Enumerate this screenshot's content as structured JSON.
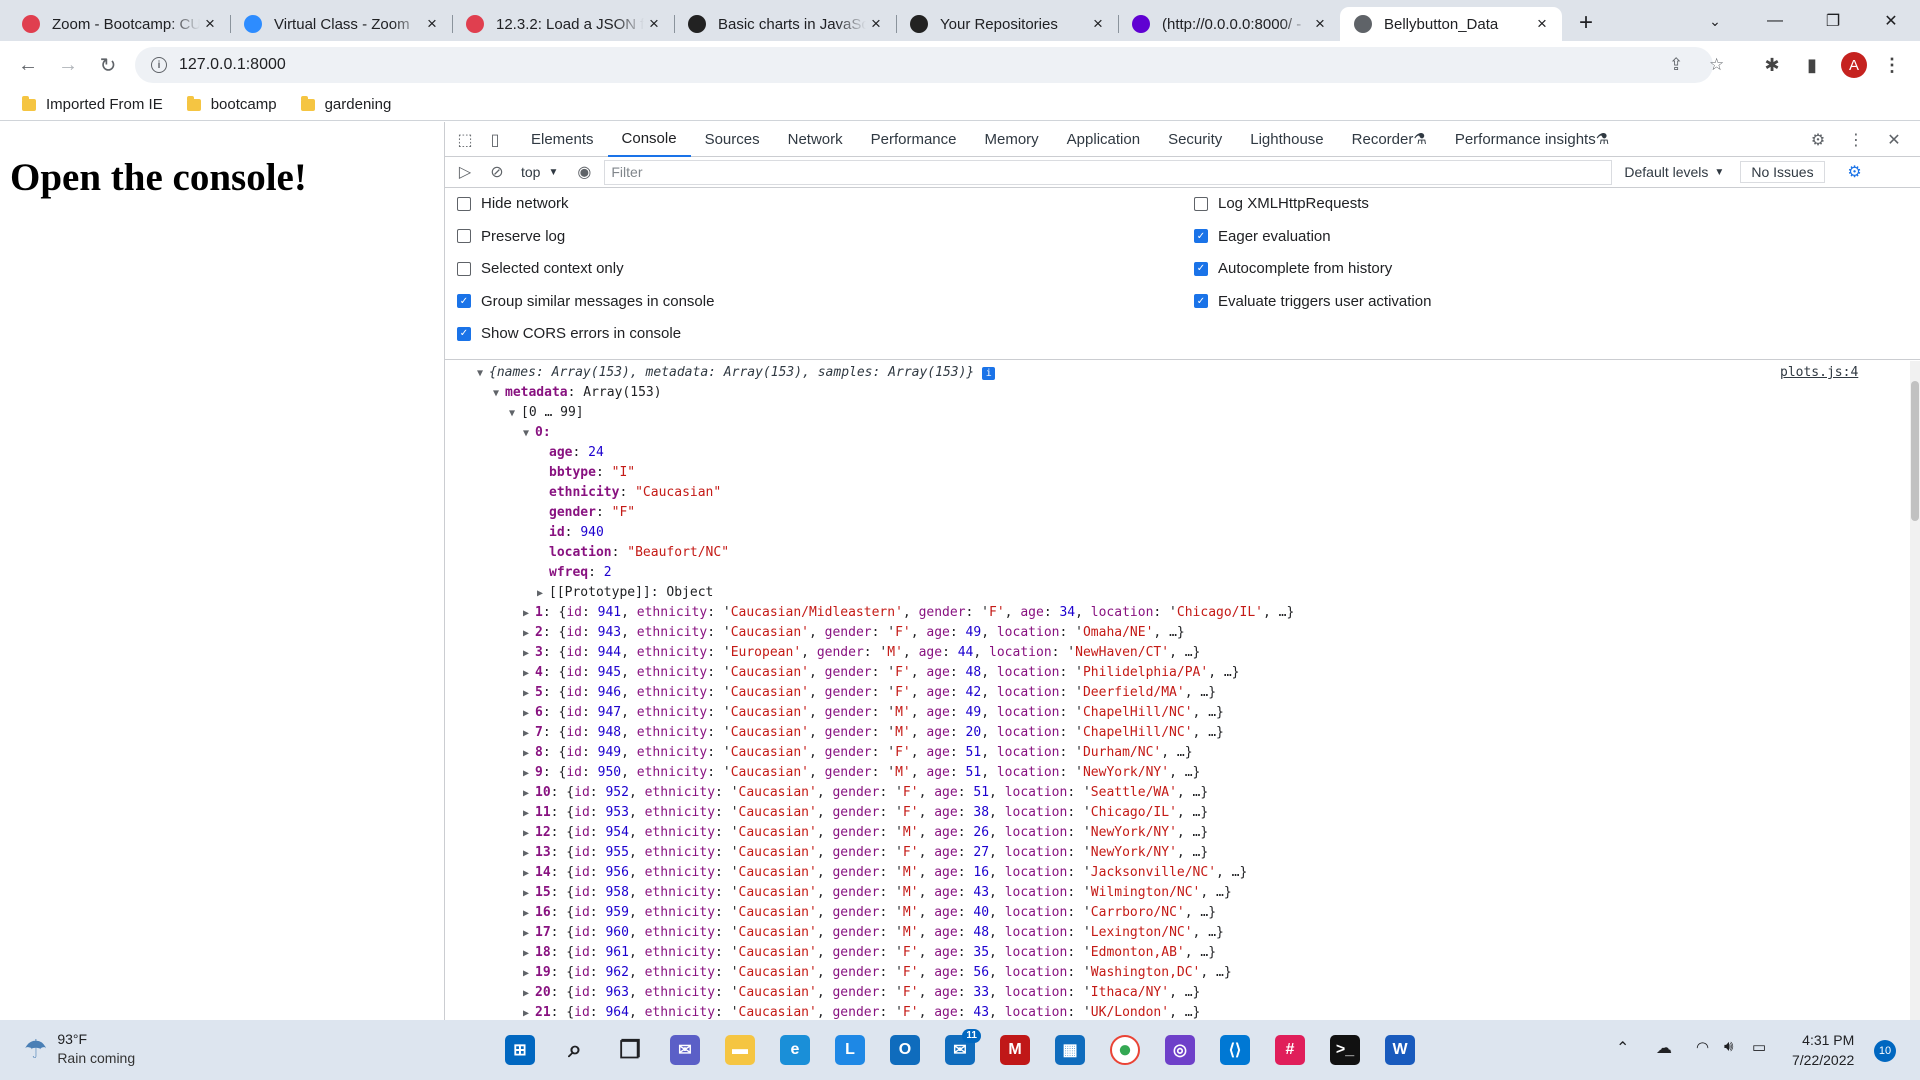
{
  "browser": {
    "tabs": [
      {
        "title": "Zoom - Bootcamp: CU",
        "icon": "bootcamp-logo-icon",
        "color": "#e03f4f"
      },
      {
        "title": "Virtual Class - Zoom",
        "icon": "zoom-icon",
        "color": "#2d8cff"
      },
      {
        "title": "12.3.2: Load a JSON file",
        "icon": "bootcamp-logo-icon",
        "color": "#e03f4f"
      },
      {
        "title": "Basic charts in JavaScript",
        "icon": "observable-icon",
        "color": "#222222"
      },
      {
        "title": "Your Repositories",
        "icon": "github-icon",
        "color": "#222222"
      },
      {
        "title": "(http://0.0.0.0:8000/ - ",
        "icon": "yahoo-icon",
        "color": "#6001d2"
      },
      {
        "title": "Bellybutton_Data",
        "icon": "globe-icon",
        "color": "#5f6368"
      }
    ],
    "active_tab": 6,
    "url": "127.0.0.1:8000",
    "avatar_letter": "A",
    "bookmarks": [
      "Imported From IE",
      "bootcamp",
      "gardening"
    ]
  },
  "page": {
    "heading": "Open the console!"
  },
  "devtools": {
    "tabs": [
      "Elements",
      "Console",
      "Sources",
      "Network",
      "Performance",
      "Memory",
      "Application",
      "Security",
      "Lighthouse",
      "Recorder",
      "Performance insights"
    ],
    "active_tab": "Console",
    "context": "top",
    "filter_placeholder": "Filter",
    "levels": "Default levels",
    "issues": "No Issues",
    "settings_left": [
      {
        "label": "Hide network",
        "checked": false
      },
      {
        "label": "Preserve log",
        "checked": false
      },
      {
        "label": "Selected context only",
        "checked": false
      },
      {
        "label": "Group similar messages in console",
        "checked": true
      },
      {
        "label": "Show CORS errors in console",
        "checked": true
      }
    ],
    "settings_right": [
      {
        "label": "Log XMLHttpRequests",
        "checked": false
      },
      {
        "label": "Eager evaluation",
        "checked": true
      },
      {
        "label": "Autocomplete from history",
        "checked": true
      },
      {
        "label": "Evaluate triggers user activation",
        "checked": true
      }
    ],
    "source_link": "plots.js:4",
    "summary": "{names: Array(153), metadata: Array(153), samples: Array(153)}",
    "metadata_label": "metadata",
    "metadata_value": "Array(153)",
    "range": "[0 … 99]",
    "item0": {
      "index": "0",
      "fields": [
        {
          "k": "age",
          "v": "24",
          "t": "n"
        },
        {
          "k": "bbtype",
          "v": "\"I\"",
          "t": "s"
        },
        {
          "k": "ethnicity",
          "v": "\"Caucasian\"",
          "t": "s"
        },
        {
          "k": "gender",
          "v": "\"F\"",
          "t": "s"
        },
        {
          "k": "id",
          "v": "940",
          "t": "n"
        },
        {
          "k": "location",
          "v": "\"Beaufort/NC\"",
          "t": "s"
        },
        {
          "k": "wfreq",
          "v": "2",
          "t": "n"
        }
      ],
      "prototype": "[[Prototype]]: Object"
    },
    "rows": [
      {
        "i": "1",
        "id": "941",
        "eth": "Caucasian/Midleastern",
        "g": "F",
        "age": "34",
        "loc": "Chicago/IL",
        "tail": ", …}"
      },
      {
        "i": "2",
        "id": "943",
        "eth": "Caucasian",
        "g": "F",
        "age": "49",
        "loc": "Omaha/NE",
        "tail": ", …}"
      },
      {
        "i": "3",
        "id": "944",
        "eth": "European",
        "g": "M",
        "age": "44",
        "loc": "NewHaven/CT",
        "tail": ", …}"
      },
      {
        "i": "4",
        "id": "945",
        "eth": "Caucasian",
        "g": "F",
        "age": "48",
        "loc": "Philidelphia/PA",
        "tail": ", …}"
      },
      {
        "i": "5",
        "id": "946",
        "eth": "Caucasian",
        "g": "F",
        "age": "42",
        "loc": "Deerfield/MA",
        "tail": ", …}"
      },
      {
        "i": "6",
        "id": "947",
        "eth": "Caucasian",
        "g": "M",
        "age": "49",
        "loc": "ChapelHill/NC",
        "tail": ", …}"
      },
      {
        "i": "7",
        "id": "948",
        "eth": "Caucasian",
        "g": "M",
        "age": "20",
        "loc": "ChapelHill/NC",
        "tail": ", …}"
      },
      {
        "i": "8",
        "id": "949",
        "eth": "Caucasian",
        "g": "F",
        "age": "51",
        "loc": "Durham/NC",
        "tail": ", …}"
      },
      {
        "i": "9",
        "id": "950",
        "eth": "Caucasian",
        "g": "M",
        "age": "51",
        "loc": "NewYork/NY",
        "tail": ", …}"
      },
      {
        "i": "10",
        "id": "952",
        "eth": "Caucasian",
        "g": "F",
        "age": "51",
        "loc": "Seattle/WA",
        "tail": ", …}"
      },
      {
        "i": "11",
        "id": "953",
        "eth": "Caucasian",
        "g": "F",
        "age": "38",
        "loc": "Chicago/IL",
        "tail": ", …}"
      },
      {
        "i": "12",
        "id": "954",
        "eth": "Caucasian",
        "g": "M",
        "age": "26",
        "loc": "NewYork/NY",
        "tail": ", …}"
      },
      {
        "i": "13",
        "id": "955",
        "eth": "Caucasian",
        "g": "F",
        "age": "27",
        "loc": "NewYork/NY",
        "tail": ", …}"
      },
      {
        "i": "14",
        "id": "956",
        "eth": "Caucasian",
        "g": "M",
        "age": "16",
        "loc": "Jacksonville/NC",
        "tail": ", …}"
      },
      {
        "i": "15",
        "id": "958",
        "eth": "Caucasian",
        "g": "M",
        "age": "43",
        "loc": "Wilmington/NC",
        "tail": ", …}"
      },
      {
        "i": "16",
        "id": "959",
        "eth": "Caucasian",
        "g": "M",
        "age": "40",
        "loc": "Carrboro/NC",
        "tail": ", …}"
      },
      {
        "i": "17",
        "id": "960",
        "eth": "Caucasian",
        "g": "M",
        "age": "48",
        "loc": "Lexington/NC",
        "tail": ", …}"
      },
      {
        "i": "18",
        "id": "961",
        "eth": "Caucasian",
        "g": "F",
        "age": "35",
        "loc": "Edmonton,AB",
        "tail": ", …}"
      },
      {
        "i": "19",
        "id": "962",
        "eth": "Caucasian",
        "g": "F",
        "age": "56",
        "loc": "Washington,DC",
        "tail": ", …}"
      },
      {
        "i": "20",
        "id": "963",
        "eth": "Caucasian",
        "g": "F",
        "age": "33",
        "loc": "Ithaca/NY",
        "tail": ", …}"
      },
      {
        "i": "21",
        "id": "964",
        "eth": "Caucasian",
        "g": "F",
        "age": "43",
        "loc": "UK/London",
        "tail": ", …}"
      }
    ]
  },
  "taskbar": {
    "weather_temp": "93°F",
    "weather_desc": "Rain coming",
    "time": "4:31 PM",
    "date": "7/22/2022",
    "notifications": "10",
    "apps": [
      {
        "icon": "start-icon",
        "color": "#0067c0"
      },
      {
        "icon": "search-icon",
        "color": "#202124"
      },
      {
        "icon": "task-view-icon",
        "color": "#202124"
      },
      {
        "icon": "teams-chat-icon",
        "color": "#5b5fc7"
      },
      {
        "icon": "file-explorer-icon",
        "color": "#f5c542"
      },
      {
        "icon": "edge-icon",
        "color": "#1a8fd8"
      },
      {
        "icon": "l-app-icon",
        "color": "#1e88e5"
      },
      {
        "icon": "outlook-icon",
        "color": "#0f6cbd"
      },
      {
        "icon": "mail-icon",
        "color": "#0f6cbd"
      },
      {
        "icon": "mcafee-icon",
        "color": "#c01818"
      },
      {
        "icon": "store-icon",
        "color": "#0f6cbd"
      },
      {
        "icon": "chrome-icon",
        "color": "#34a853"
      },
      {
        "icon": "github-desktop-icon",
        "color": "#6e40c9"
      },
      {
        "icon": "vscode-icon",
        "color": "#0078d4"
      },
      {
        "icon": "slack-icon",
        "color": "#e01e5a"
      },
      {
        "icon": "terminal-icon",
        "color": "#111111"
      },
      {
        "icon": "word-icon",
        "color": "#185abd"
      }
    ],
    "mail_badge": "11"
  }
}
